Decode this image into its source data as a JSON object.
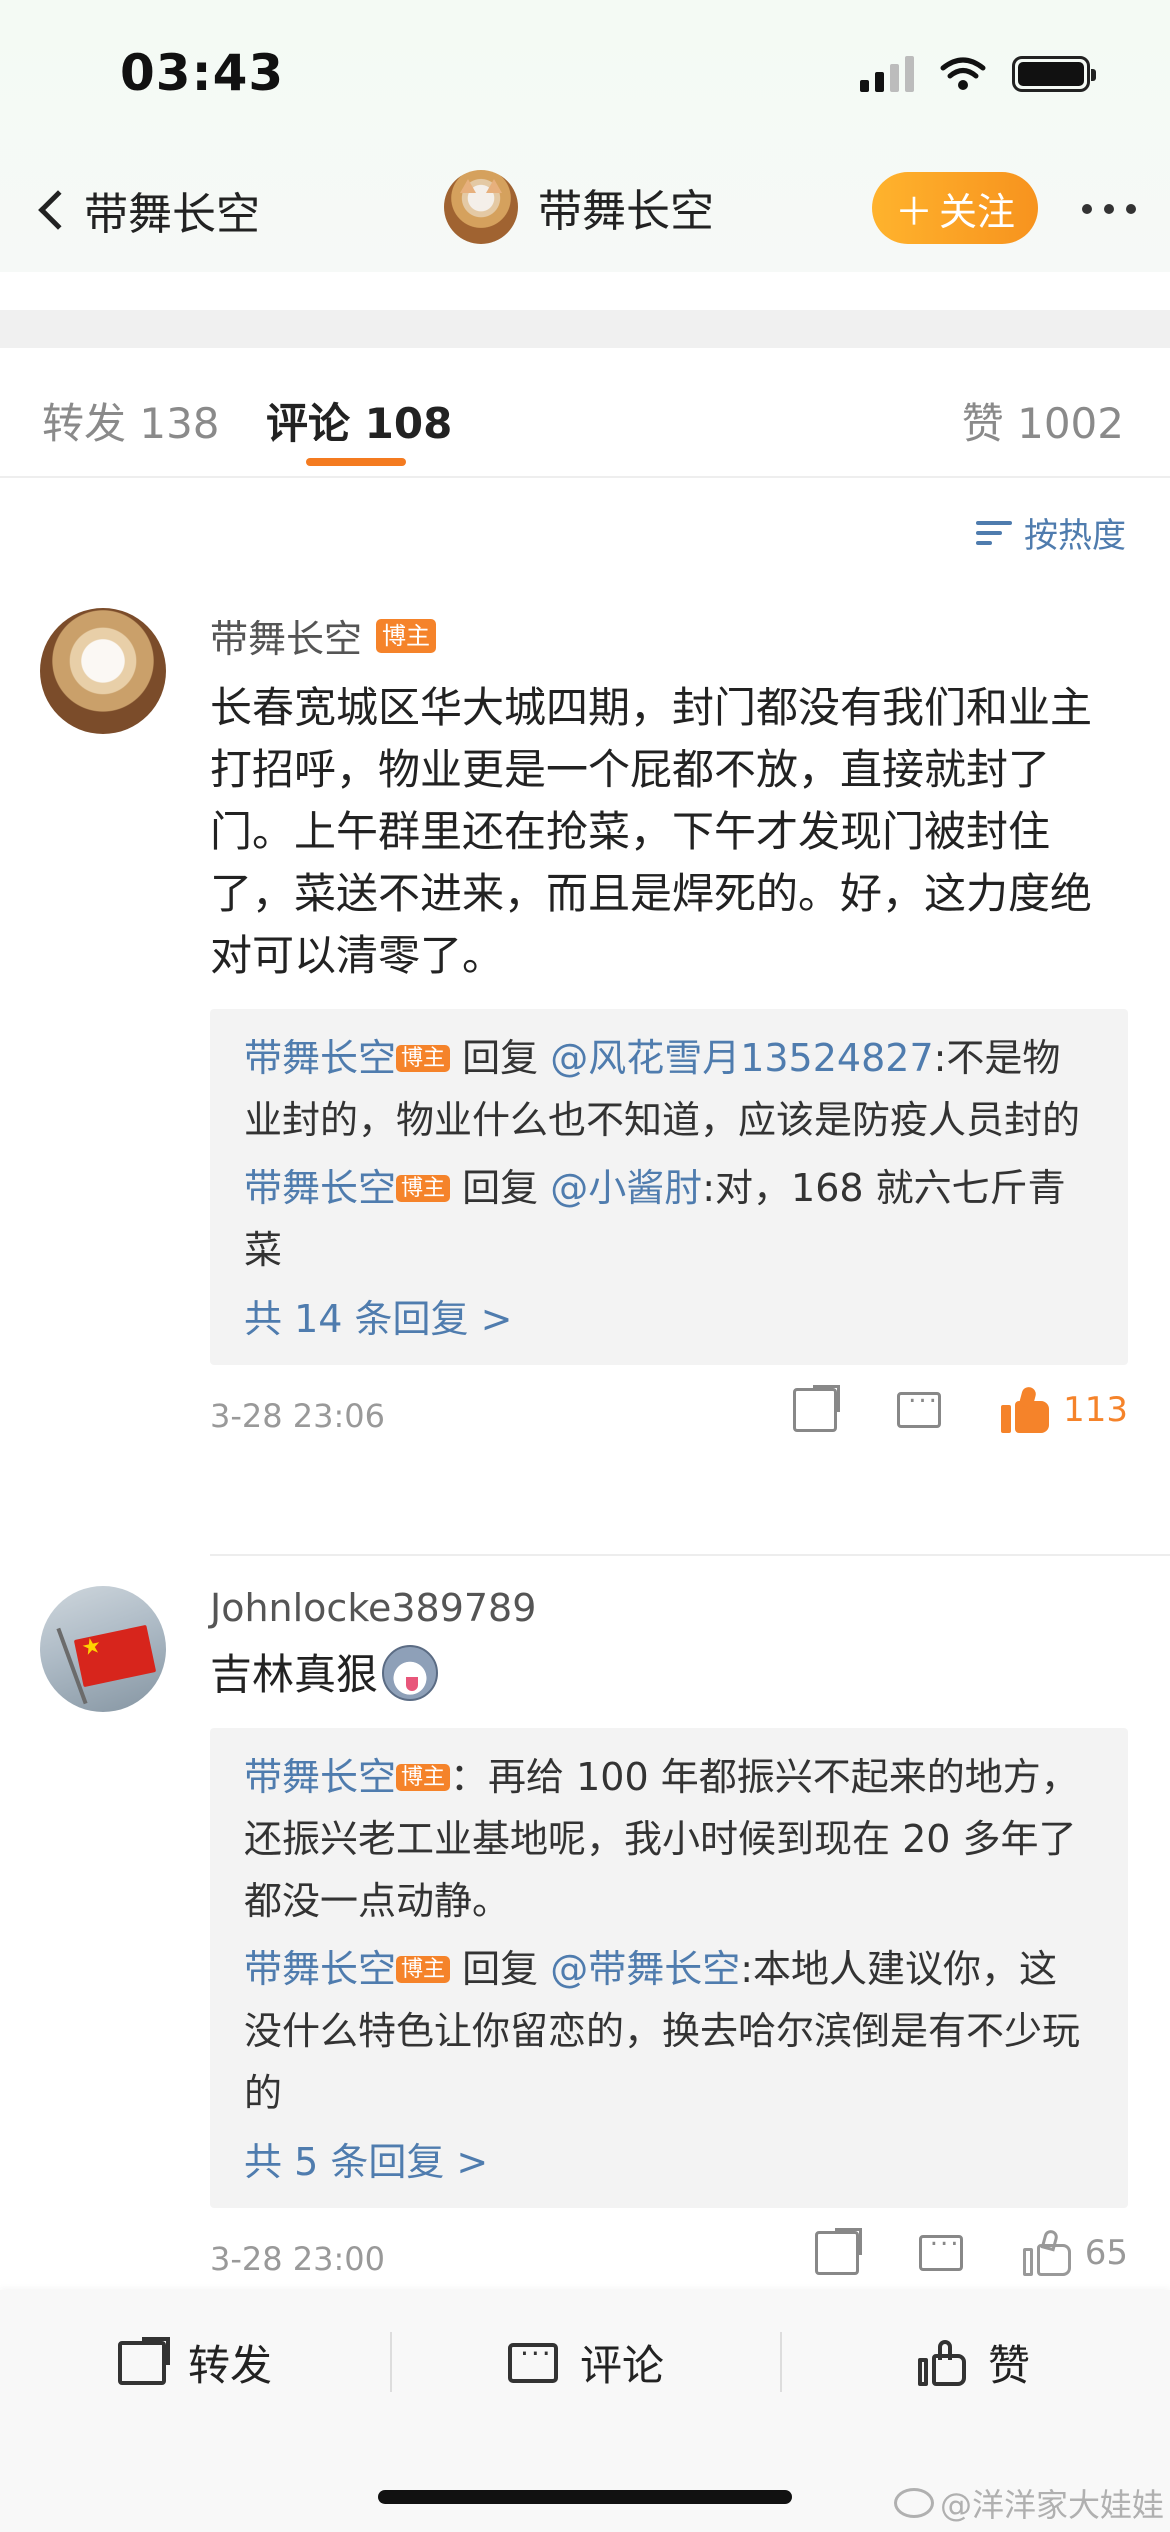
{
  "status_bar": {
    "time": "03:43"
  },
  "nav": {
    "back_label": "带舞长空",
    "center_name": "带舞长空",
    "follow_label": "关注"
  },
  "tabs": {
    "repost": "转发 138",
    "comment": "评论 108",
    "like": "赞 1002"
  },
  "sort": {
    "label": "按热度"
  },
  "comments": [
    {
      "user": "带舞长空",
      "badge": "博主",
      "text": "长春宽城区华大城四期，封门都没有我们和业主打招呼，物业更是一个屁都不放，直接就封了门。上午群里还在抢菜，下午才发现门被封住了，菜送不进来，而且是焊死的。好，这力度绝对可以清零了。",
      "replies": [
        {
          "user": "带舞长空",
          "badge": "博主",
          "mid": " 回复 ",
          "at": "@风花雪月13524827",
          "text": ":不是物业封的，物业什么也不知道，应该是防疫人员封的"
        },
        {
          "user": "带舞长空",
          "badge": "博主",
          "mid": " 回复 ",
          "at": "@小酱肘",
          "text": ":对，168 就六七斤青菜"
        }
      ],
      "more": "共 14 条回复 >",
      "time": "3-28 23:06",
      "likes": "113"
    },
    {
      "user": "Johnlocke389789",
      "text": "吉林真狠",
      "replies": [
        {
          "user": "带舞长空",
          "badge": "博主",
          "mid": "",
          "at": "",
          "text": "：再给 100 年都振兴不起来的地方，还振兴老工业基地呢，我小时候到现在 20 多年了都没一点动静。"
        },
        {
          "user": "带舞长空",
          "badge": "博主",
          "mid": " 回复 ",
          "at": "@带舞长空",
          "text": ":本地人建议你，这没什么特色让你留恋的，换去哈尔滨倒是有不少玩的"
        }
      ],
      "more": "共 5 条回复 >",
      "time": "3-28 23:00",
      "likes": "65"
    }
  ],
  "bottom_bar": {
    "repost": "转发",
    "comment": "评论",
    "like": "赞"
  },
  "watermark": "@洋洋家大娃娃",
  "colors": {
    "accent": "#f5832a",
    "link": "#4f7cae",
    "follow": "#f7931e"
  }
}
